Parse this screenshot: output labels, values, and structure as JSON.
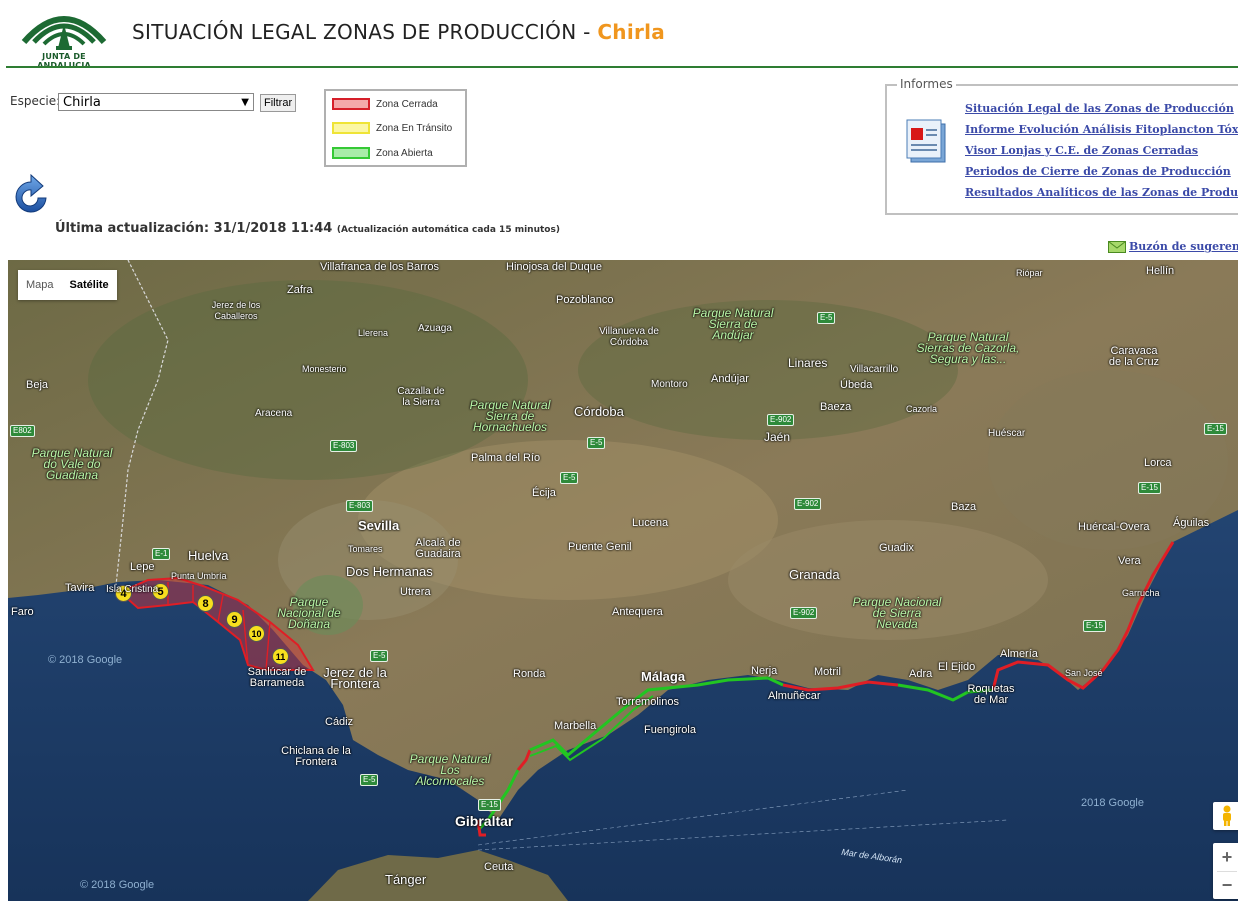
{
  "header": {
    "logo_text": "JUNTA DE ANDALUCIA",
    "title": "SITUACIÓN LEGAL ZONAS DE PRODUCCIÓN -",
    "species": "Chirla"
  },
  "filter": {
    "species_label": "Especie:",
    "species_selected": "Chirla",
    "filter_button": "Filtrar"
  },
  "legend": {
    "items": [
      {
        "label": "Zona Cerrada",
        "color": "#e8363a",
        "fill": "#f4a8aa"
      },
      {
        "label": "Zona En Tránsito",
        "color": "#f2ea3c",
        "fill": "#fbf7a4"
      },
      {
        "label": "Zona Abierta",
        "color": "#35c935",
        "fill": "#a8eca8"
      }
    ]
  },
  "update": {
    "label": "Última actualización: 31/1/2018 11:44",
    "note": "(Actualización automática cada 15 minutos)"
  },
  "informes": {
    "title": "Informes",
    "links": [
      "Situación Legal de las Zonas de Producción",
      "Informe Evolución Análisis Fitoplancton Tóxico",
      "Visor Lonjas y C.E. de Zonas Cerradas",
      "Periodos de Cierre de Zonas de Producción",
      "Resultados Analíticos de las Zonas de Producción"
    ]
  },
  "buzon": "Buzón de sugerencia",
  "map": {
    "type_buttons": [
      "Mapa",
      "Satélite"
    ],
    "active_type": "Satélite",
    "zoom_in": "+",
    "zoom_out": "−",
    "watermarks": [
      "© 2018 Google",
      "© 2018 Google",
      "2018 Google"
    ],
    "zones": [
      "4",
      "5",
      "8",
      "9",
      "10",
      "11"
    ],
    "places": [
      "Villafranca de los Barros",
      "Hinojosa del Duque",
      "Riópar",
      "Hellín",
      "Zafra",
      "Pozoblanco",
      "Jerez de los Caballeros",
      "Llerena",
      "Azuaga",
      "Villanueva de Córdoba",
      "Parque Natural Sierra de Andújar",
      "Parque Natural Sierras de Cazorla, Segura y las...",
      "Caravaca de la Cruz",
      "Monesterio",
      "Linares",
      "Villacarrillo",
      "Beja",
      "Cazalla de la Sierra",
      "Montoro",
      "Andújar",
      "Úbeda",
      "Aracena",
      "Parque Natural Sierra de Hornachuelos",
      "Córdoba",
      "Baeza",
      "Cazorla",
      "Jaén",
      "Huéscar",
      "Parque Natural do Vale do Guadiana",
      "Palma del Río",
      "Lorca",
      "Écija",
      "Baza",
      "Sevilla",
      "Lucena",
      "Huércal-Overa",
      "Águilas",
      "Tomares",
      "Alcalá de Guadaira",
      "Puente Genil",
      "Guadix",
      "Huelva",
      "Lepe",
      "Dos Hermanas",
      "Granada",
      "Vera",
      "Tavira",
      "Isla Cristina",
      "Punta Umbría",
      "Utrera",
      "Faro",
      "Parque Nacional de Doñana",
      "Antequera",
      "Parque Nacional de Sierra Nevada",
      "Garrucha",
      "Sanlúcar de Barrameda",
      "Jerez de la Frontera",
      "Ronda",
      "Málaga",
      "Nerja",
      "Motril",
      "Adra",
      "El Ejido",
      "Almería",
      "San José",
      "Almuñécar",
      "Roquetas de Mar",
      "Torremolinos",
      "Marbella",
      "Fuengirola",
      "Cádiz",
      "Chiclana de la Frontera",
      "Parque Natural Los Alcornocales",
      "Gibraltar",
      "Ceuta",
      "Tánger",
      "Mar de Alborán"
    ],
    "roads": [
      "E-5",
      "E802",
      "E-803",
      "E-5",
      "E-5",
      "E-902",
      "E-902",
      "E-15",
      "E-15",
      "E-1",
      "E-803",
      "E-5",
      "E-902",
      "E-15",
      "E-5",
      "E-15"
    ]
  }
}
